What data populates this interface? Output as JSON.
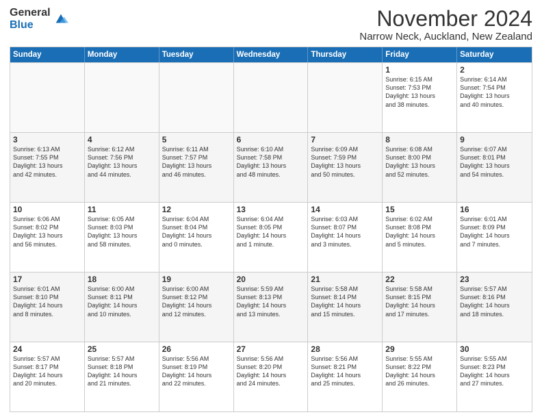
{
  "logo": {
    "general": "General",
    "blue": "Blue"
  },
  "title": "November 2024",
  "location": "Narrow Neck, Auckland, New Zealand",
  "days": [
    "Sunday",
    "Monday",
    "Tuesday",
    "Wednesday",
    "Thursday",
    "Friday",
    "Saturday"
  ],
  "rows": [
    [
      {
        "day": "",
        "info": ""
      },
      {
        "day": "",
        "info": ""
      },
      {
        "day": "",
        "info": ""
      },
      {
        "day": "",
        "info": ""
      },
      {
        "day": "",
        "info": ""
      },
      {
        "day": "1",
        "info": "Sunrise: 6:15 AM\nSunset: 7:53 PM\nDaylight: 13 hours\nand 38 minutes."
      },
      {
        "day": "2",
        "info": "Sunrise: 6:14 AM\nSunset: 7:54 PM\nDaylight: 13 hours\nand 40 minutes."
      }
    ],
    [
      {
        "day": "3",
        "info": "Sunrise: 6:13 AM\nSunset: 7:55 PM\nDaylight: 13 hours\nand 42 minutes."
      },
      {
        "day": "4",
        "info": "Sunrise: 6:12 AM\nSunset: 7:56 PM\nDaylight: 13 hours\nand 44 minutes."
      },
      {
        "day": "5",
        "info": "Sunrise: 6:11 AM\nSunset: 7:57 PM\nDaylight: 13 hours\nand 46 minutes."
      },
      {
        "day": "6",
        "info": "Sunrise: 6:10 AM\nSunset: 7:58 PM\nDaylight: 13 hours\nand 48 minutes."
      },
      {
        "day": "7",
        "info": "Sunrise: 6:09 AM\nSunset: 7:59 PM\nDaylight: 13 hours\nand 50 minutes."
      },
      {
        "day": "8",
        "info": "Sunrise: 6:08 AM\nSunset: 8:00 PM\nDaylight: 13 hours\nand 52 minutes."
      },
      {
        "day": "9",
        "info": "Sunrise: 6:07 AM\nSunset: 8:01 PM\nDaylight: 13 hours\nand 54 minutes."
      }
    ],
    [
      {
        "day": "10",
        "info": "Sunrise: 6:06 AM\nSunset: 8:02 PM\nDaylight: 13 hours\nand 56 minutes."
      },
      {
        "day": "11",
        "info": "Sunrise: 6:05 AM\nSunset: 8:03 PM\nDaylight: 13 hours\nand 58 minutes."
      },
      {
        "day": "12",
        "info": "Sunrise: 6:04 AM\nSunset: 8:04 PM\nDaylight: 14 hours\nand 0 minutes."
      },
      {
        "day": "13",
        "info": "Sunrise: 6:04 AM\nSunset: 8:05 PM\nDaylight: 14 hours\nand 1 minute."
      },
      {
        "day": "14",
        "info": "Sunrise: 6:03 AM\nSunset: 8:07 PM\nDaylight: 14 hours\nand 3 minutes."
      },
      {
        "day": "15",
        "info": "Sunrise: 6:02 AM\nSunset: 8:08 PM\nDaylight: 14 hours\nand 5 minutes."
      },
      {
        "day": "16",
        "info": "Sunrise: 6:01 AM\nSunset: 8:09 PM\nDaylight: 14 hours\nand 7 minutes."
      }
    ],
    [
      {
        "day": "17",
        "info": "Sunrise: 6:01 AM\nSunset: 8:10 PM\nDaylight: 14 hours\nand 8 minutes."
      },
      {
        "day": "18",
        "info": "Sunrise: 6:00 AM\nSunset: 8:11 PM\nDaylight: 14 hours\nand 10 minutes."
      },
      {
        "day": "19",
        "info": "Sunrise: 6:00 AM\nSunset: 8:12 PM\nDaylight: 14 hours\nand 12 minutes."
      },
      {
        "day": "20",
        "info": "Sunrise: 5:59 AM\nSunset: 8:13 PM\nDaylight: 14 hours\nand 13 minutes."
      },
      {
        "day": "21",
        "info": "Sunrise: 5:58 AM\nSunset: 8:14 PM\nDaylight: 14 hours\nand 15 minutes."
      },
      {
        "day": "22",
        "info": "Sunrise: 5:58 AM\nSunset: 8:15 PM\nDaylight: 14 hours\nand 17 minutes."
      },
      {
        "day": "23",
        "info": "Sunrise: 5:57 AM\nSunset: 8:16 PM\nDaylight: 14 hours\nand 18 minutes."
      }
    ],
    [
      {
        "day": "24",
        "info": "Sunrise: 5:57 AM\nSunset: 8:17 PM\nDaylight: 14 hours\nand 20 minutes."
      },
      {
        "day": "25",
        "info": "Sunrise: 5:57 AM\nSunset: 8:18 PM\nDaylight: 14 hours\nand 21 minutes."
      },
      {
        "day": "26",
        "info": "Sunrise: 5:56 AM\nSunset: 8:19 PM\nDaylight: 14 hours\nand 22 minutes."
      },
      {
        "day": "27",
        "info": "Sunrise: 5:56 AM\nSunset: 8:20 PM\nDaylight: 14 hours\nand 24 minutes."
      },
      {
        "day": "28",
        "info": "Sunrise: 5:56 AM\nSunset: 8:21 PM\nDaylight: 14 hours\nand 25 minutes."
      },
      {
        "day": "29",
        "info": "Sunrise: 5:55 AM\nSunset: 8:22 PM\nDaylight: 14 hours\nand 26 minutes."
      },
      {
        "day": "30",
        "info": "Sunrise: 5:55 AM\nSunset: 8:23 PM\nDaylight: 14 hours\nand 27 minutes."
      }
    ]
  ]
}
